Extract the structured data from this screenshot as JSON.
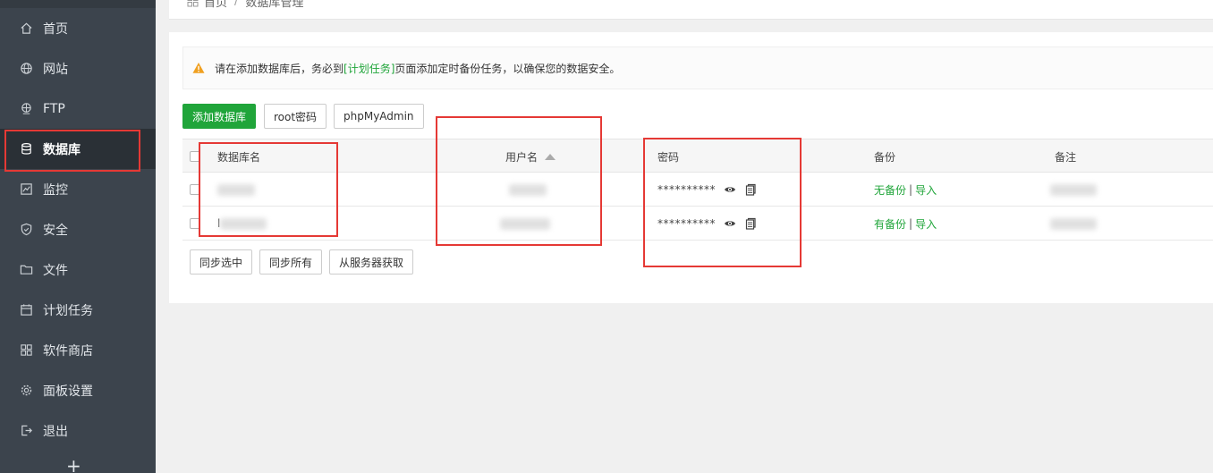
{
  "sidebar": {
    "items": [
      {
        "label": "首页",
        "icon": "home-icon"
      },
      {
        "label": "网站",
        "icon": "globe-icon"
      },
      {
        "label": "FTP",
        "icon": "ftp-icon"
      },
      {
        "label": "数据库",
        "icon": "database-icon",
        "active": true
      },
      {
        "label": "监控",
        "icon": "monitor-icon"
      },
      {
        "label": "安全",
        "icon": "shield-icon"
      },
      {
        "label": "文件",
        "icon": "folder-icon"
      },
      {
        "label": "计划任务",
        "icon": "calendar-icon"
      },
      {
        "label": "软件商店",
        "icon": "grid-icon"
      },
      {
        "label": "面板设置",
        "icon": "gear-icon"
      },
      {
        "label": "退出",
        "icon": "logout-icon"
      }
    ],
    "add_symbol": "+"
  },
  "breadcrumb": {
    "home": "首页",
    "separator": "/",
    "current": "数据库管理"
  },
  "notice": {
    "before": "请在添加数据库后，务必到",
    "link": "[计划任务]",
    "after": "页面添加定时备份任务，以确保您的数据安全。"
  },
  "toolbar": {
    "add_db": "添加数据库",
    "root_pwd": "root密码",
    "phpmyadmin": "phpMyAdmin"
  },
  "table": {
    "headers": {
      "name": "数据库名",
      "user": "用户名",
      "password": "密码",
      "backup": "备份",
      "remark": "备注"
    },
    "rows": [
      {
        "name_prefix": "",
        "password": "**********",
        "backup": "无备份",
        "import": "导入",
        "sep": "|"
      },
      {
        "name_prefix": "l",
        "password": "**********",
        "backup": "有备份",
        "import": "导入",
        "sep": "|"
      }
    ]
  },
  "footer_buttons": {
    "sync_selected": "同步选中",
    "sync_all": "同步所有",
    "fetch_server": "从服务器获取"
  },
  "colors": {
    "sidebar_bg": "#3c444d",
    "active_bg": "#2a3036",
    "accent_green": "#20a53a",
    "annotation_red": "#e53935"
  }
}
